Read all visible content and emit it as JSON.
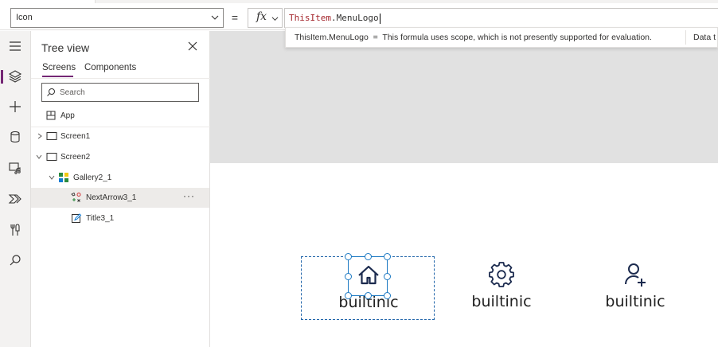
{
  "formula_bar": {
    "property": "Icon",
    "equals": "=",
    "fx_label": "fx",
    "formula_keyword": "ThisItem",
    "formula_rest": ".MenuLogo",
    "tooltip_message": "ThisItem.MenuLogo  =  This formula uses scope, which is not presently supported for evaluation.",
    "tooltip_datatype": "Data t"
  },
  "tree_view": {
    "title": "Tree view",
    "tabs": {
      "screens": "Screens",
      "components": "Components"
    },
    "search_placeholder": "Search",
    "items": {
      "app": "App",
      "screen1": "Screen1",
      "screen2": "Screen2",
      "gallery": "Gallery2_1",
      "next_arrow": "NextArrow3_1",
      "title": "Title3_1"
    },
    "more": "···"
  },
  "gallery": {
    "items": [
      {
        "label": "builtinic",
        "icon": "home-icon"
      },
      {
        "label": "builtinic",
        "icon": "gear-icon"
      },
      {
        "label": "builtinic",
        "icon": "add-user-icon"
      }
    ]
  },
  "colors": {
    "accent": "#742774",
    "selection": "#1a78c2",
    "icon_navy": "#1b2a4e",
    "formula_keyword": "#a4262c"
  }
}
